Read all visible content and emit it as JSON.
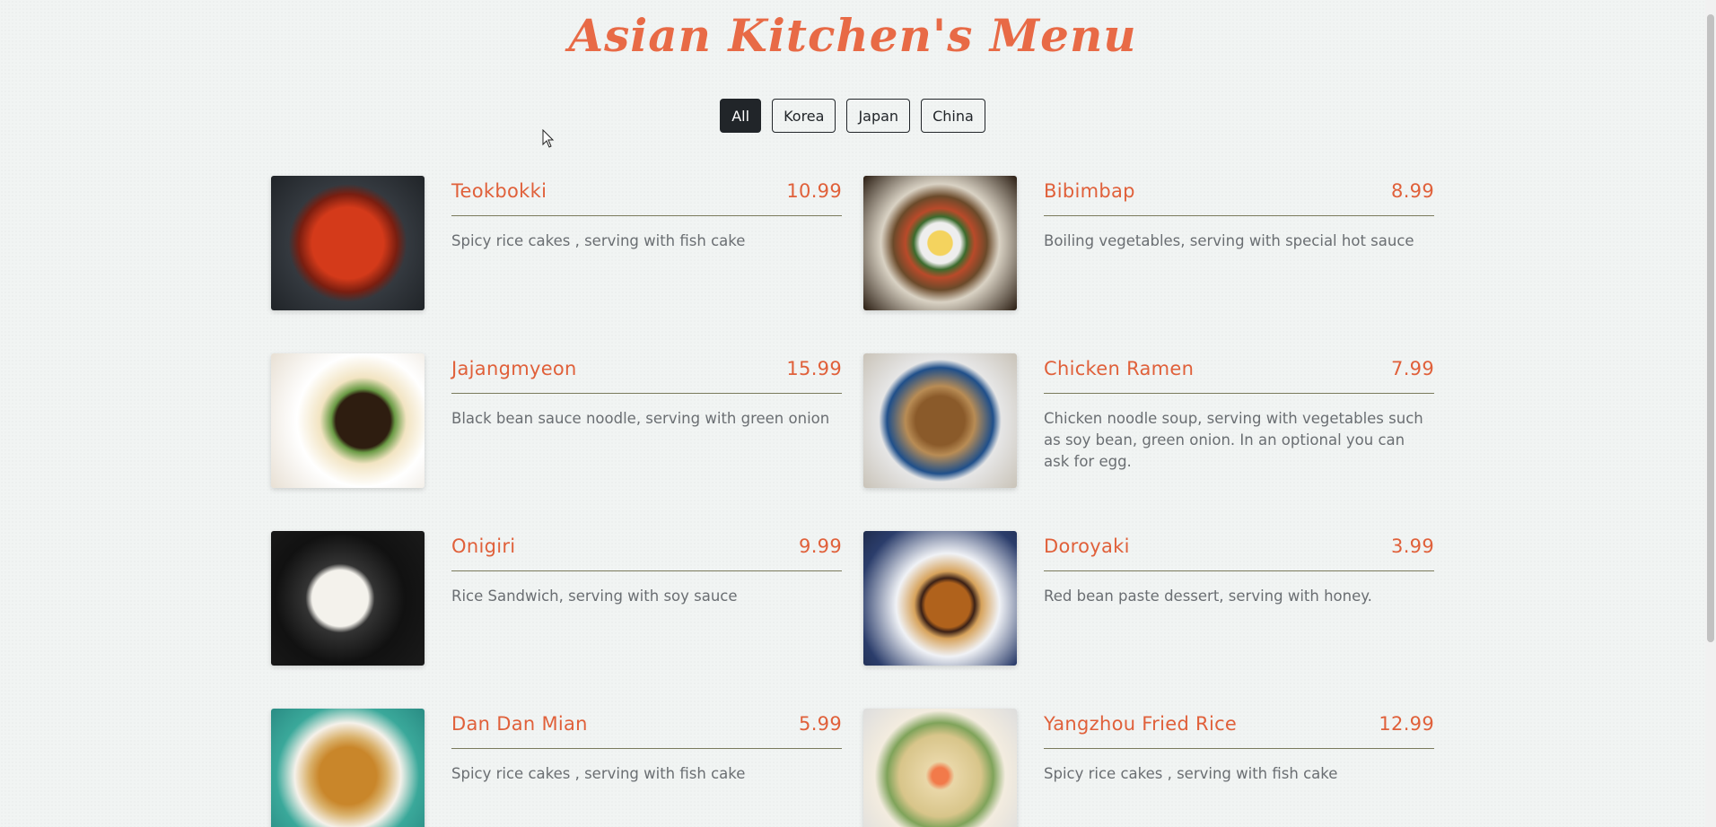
{
  "header": {
    "title": "Asian Kitchen's Menu"
  },
  "filters": [
    {
      "label": "All",
      "active": true
    },
    {
      "label": "Korea",
      "active": false
    },
    {
      "label": "Japan",
      "active": false
    },
    {
      "label": "China",
      "active": false
    }
  ],
  "menu": {
    "items": [
      {
        "name": "Teokbokki",
        "price": "10.99",
        "desc": "Spicy rice cakes , serving with fish cake",
        "image": "teokbokki-photo"
      },
      {
        "name": "Bibimbap",
        "price": "8.99",
        "desc": "Boiling vegetables, serving with special hot sauce",
        "image": "bibimbap-photo"
      },
      {
        "name": "Jajangmyeon",
        "price": "15.99",
        "desc": "Black bean sauce noodle, serving with green onion",
        "image": "jajangmyeon-photo"
      },
      {
        "name": "Chicken Ramen",
        "price": "7.99",
        "desc": "Chicken noodle soup, serving with vegetables such as soy bean, green onion. In an optional you can ask for egg.",
        "image": "chicken-ramen-photo"
      },
      {
        "name": "Onigiri",
        "price": "9.99",
        "desc": "Rice Sandwich, serving with soy sauce",
        "image": "onigiri-photo"
      },
      {
        "name": "Doroyaki",
        "price": "3.99",
        "desc": "Red bean paste dessert, serving with honey.",
        "image": "doroyaki-photo"
      },
      {
        "name": "Dan Dan Mian",
        "price": "5.99",
        "desc": "Spicy rice cakes , serving with fish cake",
        "image": "dan-dan-mian-photo"
      },
      {
        "name": "Yangzhou Fried Rice",
        "price": "12.99",
        "desc": "Spicy rice cakes , serving with fish cake",
        "image": "yangzhou-fried-rice-photo"
      }
    ]
  },
  "colors": {
    "accent": "#e0603a",
    "button_dark": "#212529",
    "background": "#f1f4f3"
  }
}
